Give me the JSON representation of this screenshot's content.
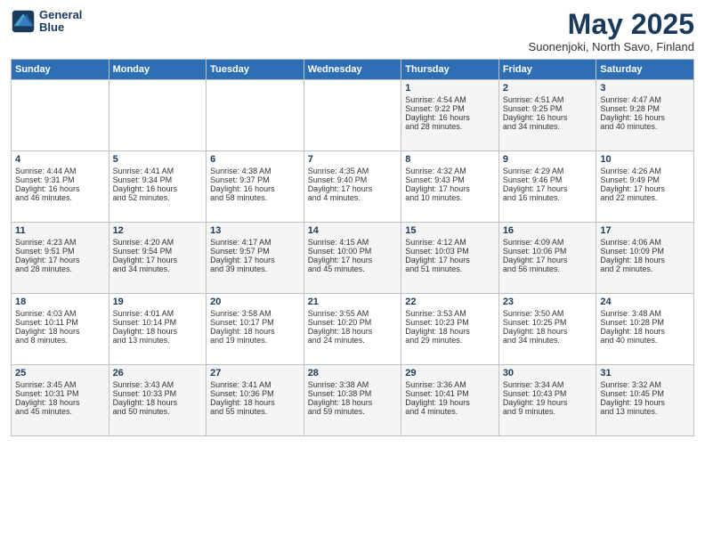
{
  "logo": {
    "line1": "General",
    "line2": "Blue"
  },
  "title": "May 2025",
  "subtitle": "Suonenjoki, North Savo, Finland",
  "days_of_week": [
    "Sunday",
    "Monday",
    "Tuesday",
    "Wednesday",
    "Thursday",
    "Friday",
    "Saturday"
  ],
  "weeks": [
    [
      {
        "day": "",
        "content": ""
      },
      {
        "day": "",
        "content": ""
      },
      {
        "day": "",
        "content": ""
      },
      {
        "day": "",
        "content": ""
      },
      {
        "day": "1",
        "content": "Sunrise: 4:54 AM\nSunset: 9:22 PM\nDaylight: 16 hours\nand 28 minutes."
      },
      {
        "day": "2",
        "content": "Sunrise: 4:51 AM\nSunset: 9:25 PM\nDaylight: 16 hours\nand 34 minutes."
      },
      {
        "day": "3",
        "content": "Sunrise: 4:47 AM\nSunset: 9:28 PM\nDaylight: 16 hours\nand 40 minutes."
      }
    ],
    [
      {
        "day": "4",
        "content": "Sunrise: 4:44 AM\nSunset: 9:31 PM\nDaylight: 16 hours\nand 46 minutes."
      },
      {
        "day": "5",
        "content": "Sunrise: 4:41 AM\nSunset: 9:34 PM\nDaylight: 16 hours\nand 52 minutes."
      },
      {
        "day": "6",
        "content": "Sunrise: 4:38 AM\nSunset: 9:37 PM\nDaylight: 16 hours\nand 58 minutes."
      },
      {
        "day": "7",
        "content": "Sunrise: 4:35 AM\nSunset: 9:40 PM\nDaylight: 17 hours\nand 4 minutes."
      },
      {
        "day": "8",
        "content": "Sunrise: 4:32 AM\nSunset: 9:43 PM\nDaylight: 17 hours\nand 10 minutes."
      },
      {
        "day": "9",
        "content": "Sunrise: 4:29 AM\nSunset: 9:46 PM\nDaylight: 17 hours\nand 16 minutes."
      },
      {
        "day": "10",
        "content": "Sunrise: 4:26 AM\nSunset: 9:49 PM\nDaylight: 17 hours\nand 22 minutes."
      }
    ],
    [
      {
        "day": "11",
        "content": "Sunrise: 4:23 AM\nSunset: 9:51 PM\nDaylight: 17 hours\nand 28 minutes."
      },
      {
        "day": "12",
        "content": "Sunrise: 4:20 AM\nSunset: 9:54 PM\nDaylight: 17 hours\nand 34 minutes."
      },
      {
        "day": "13",
        "content": "Sunrise: 4:17 AM\nSunset: 9:57 PM\nDaylight: 17 hours\nand 39 minutes."
      },
      {
        "day": "14",
        "content": "Sunrise: 4:15 AM\nSunset: 10:00 PM\nDaylight: 17 hours\nand 45 minutes."
      },
      {
        "day": "15",
        "content": "Sunrise: 4:12 AM\nSunset: 10:03 PM\nDaylight: 17 hours\nand 51 minutes."
      },
      {
        "day": "16",
        "content": "Sunrise: 4:09 AM\nSunset: 10:06 PM\nDaylight: 17 hours\nand 56 minutes."
      },
      {
        "day": "17",
        "content": "Sunrise: 4:06 AM\nSunset: 10:09 PM\nDaylight: 18 hours\nand 2 minutes."
      }
    ],
    [
      {
        "day": "18",
        "content": "Sunrise: 4:03 AM\nSunset: 10:11 PM\nDaylight: 18 hours\nand 8 minutes."
      },
      {
        "day": "19",
        "content": "Sunrise: 4:01 AM\nSunset: 10:14 PM\nDaylight: 18 hours\nand 13 minutes."
      },
      {
        "day": "20",
        "content": "Sunrise: 3:58 AM\nSunset: 10:17 PM\nDaylight: 18 hours\nand 19 minutes."
      },
      {
        "day": "21",
        "content": "Sunrise: 3:55 AM\nSunset: 10:20 PM\nDaylight: 18 hours\nand 24 minutes."
      },
      {
        "day": "22",
        "content": "Sunrise: 3:53 AM\nSunset: 10:23 PM\nDaylight: 18 hours\nand 29 minutes."
      },
      {
        "day": "23",
        "content": "Sunrise: 3:50 AM\nSunset: 10:25 PM\nDaylight: 18 hours\nand 34 minutes."
      },
      {
        "day": "24",
        "content": "Sunrise: 3:48 AM\nSunset: 10:28 PM\nDaylight: 18 hours\nand 40 minutes."
      }
    ],
    [
      {
        "day": "25",
        "content": "Sunrise: 3:45 AM\nSunset: 10:31 PM\nDaylight: 18 hours\nand 45 minutes."
      },
      {
        "day": "26",
        "content": "Sunrise: 3:43 AM\nSunset: 10:33 PM\nDaylight: 18 hours\nand 50 minutes."
      },
      {
        "day": "27",
        "content": "Sunrise: 3:41 AM\nSunset: 10:36 PM\nDaylight: 18 hours\nand 55 minutes."
      },
      {
        "day": "28",
        "content": "Sunrise: 3:38 AM\nSunset: 10:38 PM\nDaylight: 18 hours\nand 59 minutes."
      },
      {
        "day": "29",
        "content": "Sunrise: 3:36 AM\nSunset: 10:41 PM\nDaylight: 19 hours\nand 4 minutes."
      },
      {
        "day": "30",
        "content": "Sunrise: 3:34 AM\nSunset: 10:43 PM\nDaylight: 19 hours\nand 9 minutes."
      },
      {
        "day": "31",
        "content": "Sunrise: 3:32 AM\nSunset: 10:45 PM\nDaylight: 19 hours\nand 13 minutes."
      }
    ]
  ]
}
